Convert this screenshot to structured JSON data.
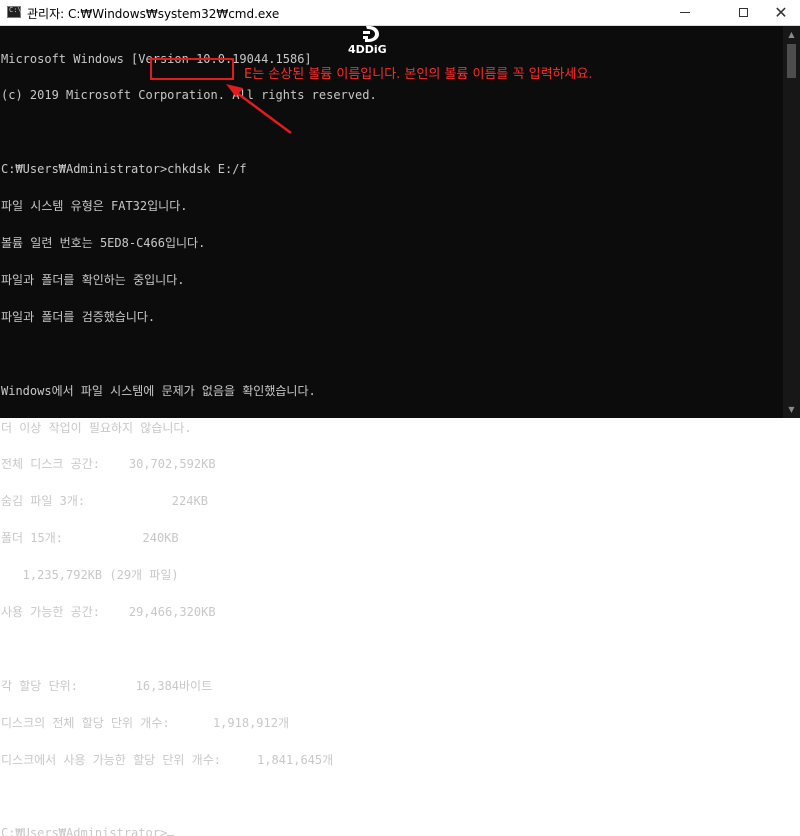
{
  "window": {
    "title": "관리자: C:₩Windows₩system32₩cmd.exe",
    "icons": {
      "app": "cmd-icon",
      "minimize": "minimize-icon",
      "maximize": "maximize-icon",
      "close": "close-icon"
    }
  },
  "console": {
    "lines": [
      "Microsoft Windows [Version 10.0.19044.1586]",
      "(c) 2019 Microsoft Corporation. All rights reserved.",
      "",
      "C:₩Users₩Administrator>chkdsk E:/f",
      "파일 시스템 유형은 FAT32입니다.",
      "볼륨 일련 번호는 5ED8-C466입니다.",
      "파일과 폴더를 확인하는 중입니다.",
      "파일과 폴더를 검증했습니다.",
      "",
      "Windows에서 파일 시스템에 문제가 없음을 확인했습니다.",
      "더 이상 작업이 필요하지 않습니다.",
      "전체 디스크 공간:    30,702,592KB",
      "숨김 파일 3개:            224KB",
      "폴더 15개:           240KB",
      "   1,235,792KB (29개 파일)",
      "사용 가능한 공간:    29,466,320KB",
      "",
      "각 할당 단위:        16,384바이트",
      "디스크의 전체 할당 단위 개수:      1,918,912개",
      "디스크에서 사용 가능한 할당 단위 개수:     1,841,645개",
      "",
      "C:₩Users₩Administrator>"
    ],
    "text_color": "#c8c8c8",
    "background": "#0c0c0c"
  },
  "annotation": {
    "text": "E는 손상된 볼륨 이름입니다. 본인의 볼륨 이름를 꼭 입력하세요.",
    "color": "#e21c1c"
  },
  "logo": {
    "text": "4DDiG"
  }
}
